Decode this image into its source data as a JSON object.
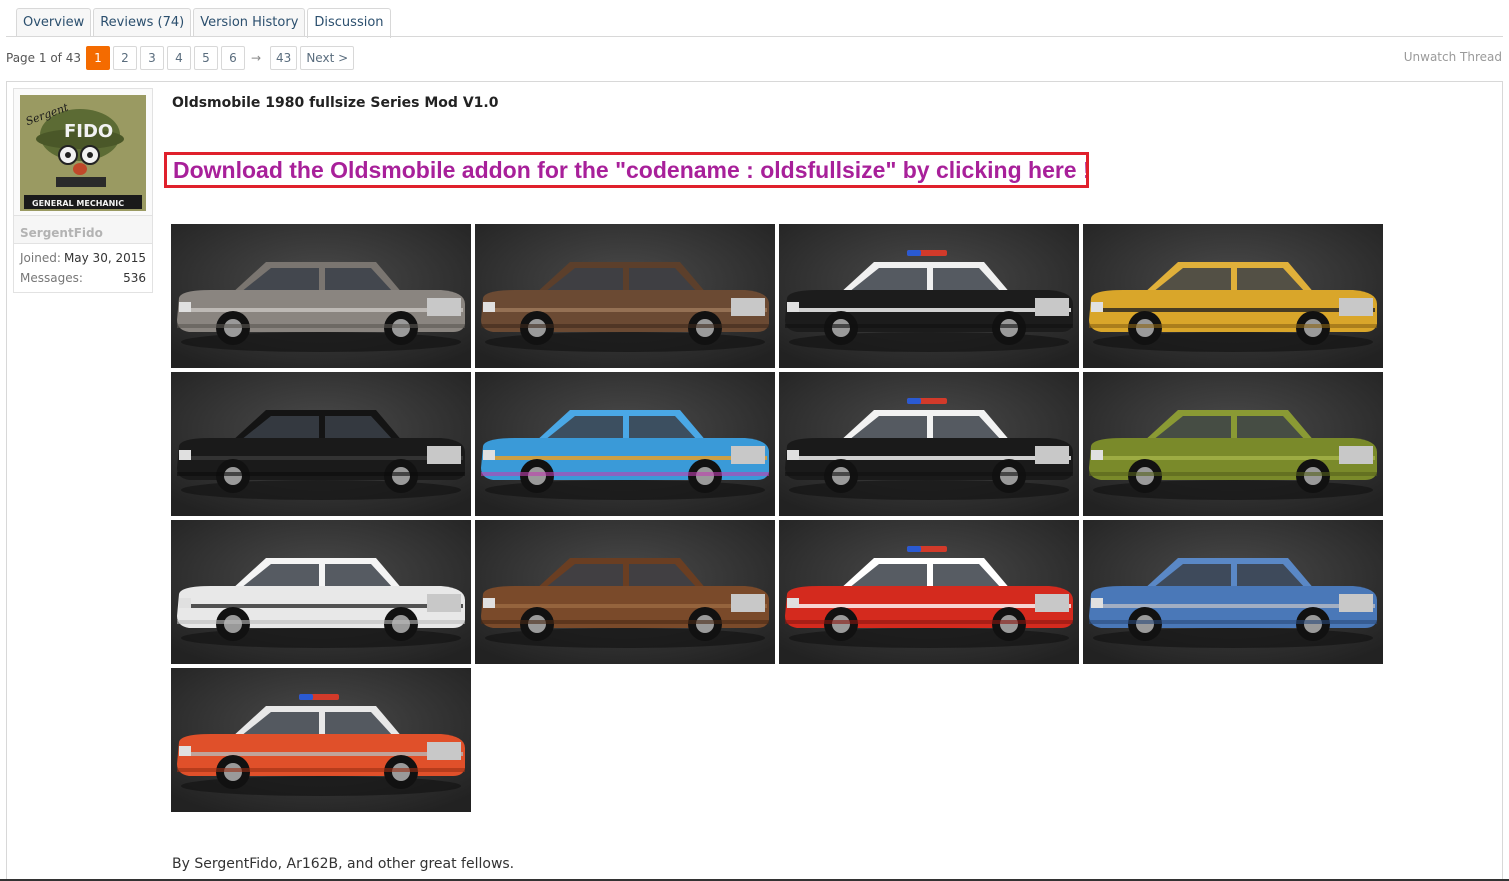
{
  "tabs": [
    {
      "label": "Overview"
    },
    {
      "label": "Reviews (74)"
    },
    {
      "label": "Version History"
    },
    {
      "label": "Discussion"
    }
  ],
  "pagination": {
    "page_label": "Page 1 of 43",
    "pages": [
      "1",
      "2",
      "3",
      "4",
      "5",
      "6"
    ],
    "current": "1",
    "arrow": "→",
    "last": "43",
    "next": "Next >"
  },
  "unwatch": "Unwatch Thread",
  "user": {
    "name": "SergentFido",
    "joined_label": "Joined:",
    "joined": "May 30, 2015",
    "messages_label": "Messages:",
    "messages": "536",
    "avatar_text": {
      "top": "Sergent",
      "main": "FIDO",
      "banner": "GENERAL MECHANIC"
    }
  },
  "post": {
    "title": "Oldsmobile 1980 fullsize Series Mod V1.0",
    "download_link": "Download the Oldsmobile addon for the \"codename : oldsfullsize\" by clicking here !",
    "byline": "By SergentFido, Ar162B, and other great fellows."
  },
  "gallery": [
    {
      "name": "car-grey",
      "body": "#8a8580",
      "roof": "#7a7570",
      "accent": "#c9c6c2",
      "tint": "#5a5652"
    },
    {
      "name": "car-brown",
      "body": "#6b4a33",
      "roof": "#5c3f2b",
      "accent": "#a07a5c",
      "tint": "#3d2a1d"
    },
    {
      "name": "car-highway-patrol",
      "body": "#1c1c1c",
      "roof": "#f0f0f0",
      "accent": "#ffffff",
      "tint": "#111111",
      "lights": true
    },
    {
      "name": "car-yellow-cab",
      "body": "#d9a62a",
      "roof": "#e0b03a",
      "accent": "#222222",
      "tint": "#8a6414"
    },
    {
      "name": "car-black",
      "body": "#1a1a1a",
      "roof": "#141414",
      "accent": "#3a3a3a",
      "tint": "#0c0c0c"
    },
    {
      "name": "car-racing-7",
      "body": "#3a9ad8",
      "roof": "#4aa8e6",
      "accent": "#f0a020",
      "tint": "#c040b0"
    },
    {
      "name": "car-police-911",
      "body": "#1a1a1a",
      "roof": "#f2f2f2",
      "accent": "#ffffff",
      "tint": "#111111",
      "lights": true
    },
    {
      "name": "car-olive",
      "body": "#7a8a2a",
      "roof": "#8a9a34",
      "accent": "#a6b44a",
      "tint": "#55601c"
    },
    {
      "name": "car-crash-test",
      "body": "#e8e8e8",
      "roof": "#f4f4f4",
      "accent": "#2a2a2a",
      "tint": "#bbbbbb"
    },
    {
      "name": "car-rusty",
      "body": "#7a4a2a",
      "roof": "#6a3e22",
      "accent": "#9c6a42",
      "tint": "#4a2a16"
    },
    {
      "name": "car-fire-chief",
      "body": "#d42a1e",
      "roof": "#ffffff",
      "accent": "#ffffff",
      "tint": "#8a1810",
      "lights": true
    },
    {
      "name": "car-blue-grand-sport",
      "body": "#4a78b8",
      "roof": "#5a88c6",
      "accent": "#b8bcc4",
      "tint": "#2a4a7a"
    },
    {
      "name": "car-orange-custom",
      "body": "#e0502a",
      "roof": "#e8e8e8",
      "accent": "#b8b8b8",
      "tint": "#9a2e14",
      "lights": true
    }
  ]
}
